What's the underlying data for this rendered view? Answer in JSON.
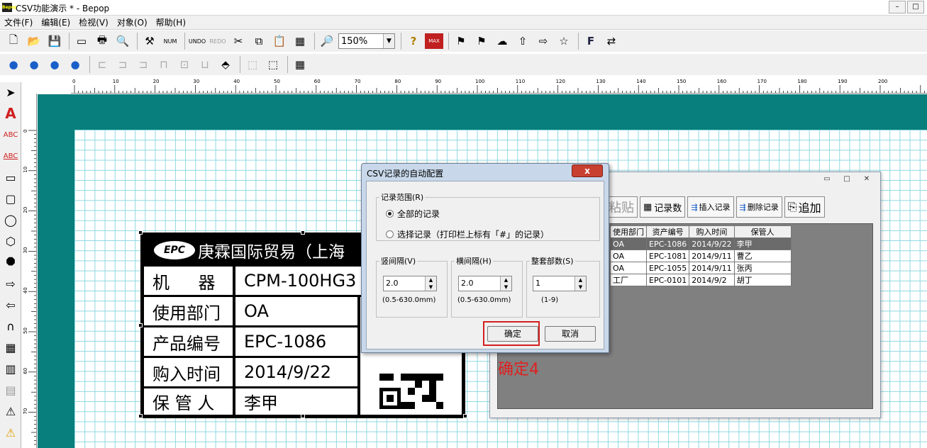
{
  "window": {
    "title": "CSV功能演示 * - Bepop",
    "icon_text": "Bepop"
  },
  "titlebar_buttons": [
    "–",
    "□"
  ],
  "menu": [
    "文件(F)",
    "编辑(E)",
    "检视(V)",
    "对象(O)",
    "帮助(H)"
  ],
  "toolbar": {
    "zoom": "150%",
    "undo": "UNDO",
    "redo": "REDO",
    "num": "NUM",
    "help": "?",
    "max": "MAX"
  },
  "ruler": {
    "top_labels": [
      "0",
      "10",
      "20",
      "30",
      "40",
      "50",
      "60",
      "70",
      "80",
      "90",
      "100",
      "110",
      "120",
      "130",
      "140",
      "150",
      "160",
      "170",
      "180",
      "190",
      "200"
    ],
    "left_labels": [
      "0",
      "10",
      "20",
      "30",
      "40",
      "50",
      "60",
      "70"
    ]
  },
  "label": {
    "company": "庚霖国际贸易（上海",
    "logo": "EPC",
    "rows": [
      {
        "key": "机    器",
        "value": "CPM-100HG3"
      },
      {
        "key": "使用部门",
        "value": "OA"
      },
      {
        "key": "产品编号",
        "value": "EPC-1086"
      },
      {
        "key": "购入时间",
        "value": "2014/9/22"
      },
      {
        "key": "保 管 人",
        "value": "李甲"
      }
    ]
  },
  "csv_window": {
    "buttons": {
      "paste": "粘贴",
      "count": "记录数",
      "insert": "插入记录",
      "delete": "删除记录",
      "append": "追加"
    },
    "columns": [
      "使用部门",
      "资产编号",
      "购入时间",
      "保管人"
    ],
    "rows": [
      [
        "OA",
        "EPC-1086",
        "2014/9/22",
        "李甲"
      ],
      [
        "OA",
        "EPC-1081",
        "2014/9/11",
        "曹乙"
      ],
      [
        "OA",
        "EPC-1055",
        "2014/9/11",
        "张丙"
      ],
      [
        "工厂",
        "EPC-0101",
        "2014/9/2",
        "胡丁"
      ]
    ]
  },
  "overlay_note": "确定4",
  "dialog": {
    "title": "CSV记录的自动配置",
    "close": "x",
    "range_group": "记录范围(R)",
    "option_all": "全部的记录",
    "option_selected": "选择记录（打印栏上标有「#」的记录）",
    "vertical": {
      "label": "竖间隔(V)",
      "value": "2.0",
      "hint": "(0.5-630.0mm)"
    },
    "horizontal": {
      "label": "横间隔(H)",
      "value": "2.0",
      "hint": "(0.5-630.0mm)"
    },
    "copies": {
      "label": "整套部数(S)",
      "value": "1",
      "hint": "(1-9)"
    },
    "ok": "确定",
    "cancel": "取消"
  }
}
